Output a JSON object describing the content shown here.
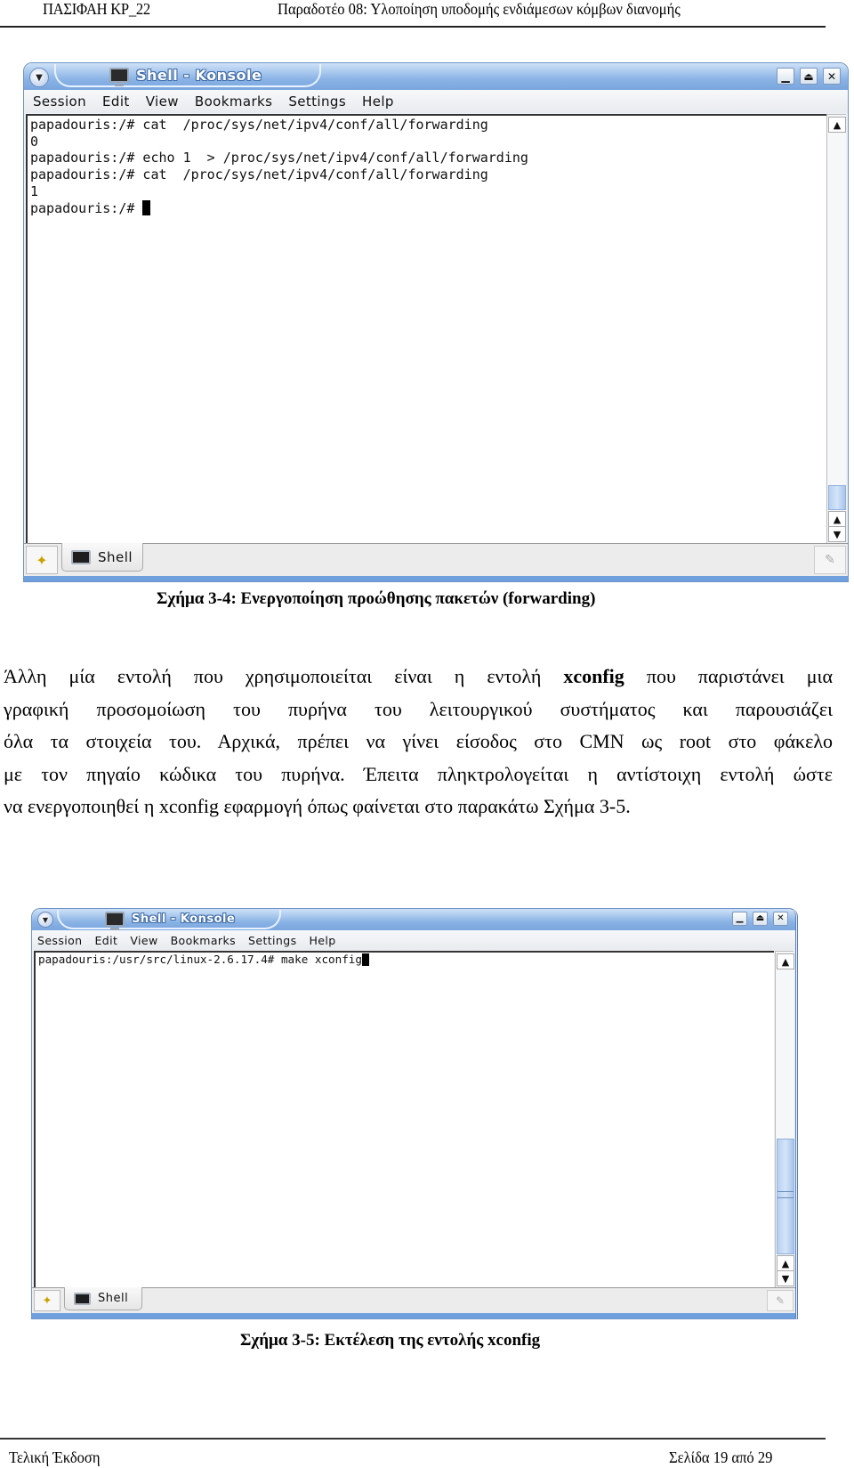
{
  "header": {
    "left": "ΠΑΣΙΦΑΗ ΚΡ_22",
    "right": "Παραδοτέο 08: Υλοποίηση υποδομής ενδιάμεσων κόμβων διανομής"
  },
  "figure1": {
    "window_title": "Shell - Konsole",
    "menu": [
      "Session",
      "Edit",
      "View",
      "Bookmarks",
      "Settings",
      "Help"
    ],
    "terminal_lines": [
      "papadouris:/# cat  /proc/sys/net/ipv4/conf/all/forwarding",
      "0",
      "papadouris:/# echo 1  > /proc/sys/net/ipv4/conf/all/forwarding",
      "papadouris:/# cat  /proc/sys/net/ipv4/conf/all/forwarding",
      "1"
    ],
    "prompt": "papadouris:/# ",
    "tab_label": "Shell",
    "icons": {
      "menu": "chevron-down-icon",
      "minimize": "minimize-icon",
      "maximize": "maximize-icon",
      "close": "close-icon",
      "new_tab": "new-session-icon",
      "tab": "terminal-icon",
      "close_tab": "close-session-icon",
      "scroll_up": "arrow-up-icon",
      "scroll_down": "arrow-down-icon"
    },
    "caption": "Σχήμα 3-4: Ενεργοποίηση προώθησης πακετών (forwarding)"
  },
  "body": {
    "lines": [
      [
        "Άλλη μία εντολή που χρησιμοποιείται είναι η εντολή ",
        "xconfig",
        " που παριστάνει μια"
      ],
      [
        "γραφική προσομοίωση του πυρήνα του λειτουργικού συστήματος και παρουσιάζει"
      ],
      [
        "όλα τα στοιχεία του. Αρχικά, πρέπει να γίνει είσοδος στο CMN ως root στο φάκελο"
      ],
      [
        "με τον πηγαίο κώδικα του πυρήνα. Έπειτα πληκτρολογείται η αντίστοιχη εντολή ώστε"
      ],
      [
        "να ενεργοποιηθεί  η xconfig εφαρμογή όπως φαίνεται στο παρακάτω Σχήμα 3-5."
      ]
    ]
  },
  "figure2": {
    "window_title": "Shell - Konsole",
    "menu": [
      "Session",
      "Edit",
      "View",
      "Bookmarks",
      "Settings",
      "Help"
    ],
    "prompt": "papadouris:/usr/src/linux-2.6.17.4# make xconfig",
    "tab_label": "Shell",
    "caption": "Σχήμα 3-5: Εκτέλεση της εντολής xconfig"
  },
  "footer": {
    "left": "Τελική Έκδοση",
    "right": "Σελίδα 19 από 29"
  },
  "colors": {
    "titlebar": "#8ab3e5",
    "window_border": "#6f93c9",
    "scroll_thumb": "#b7d0f0"
  }
}
